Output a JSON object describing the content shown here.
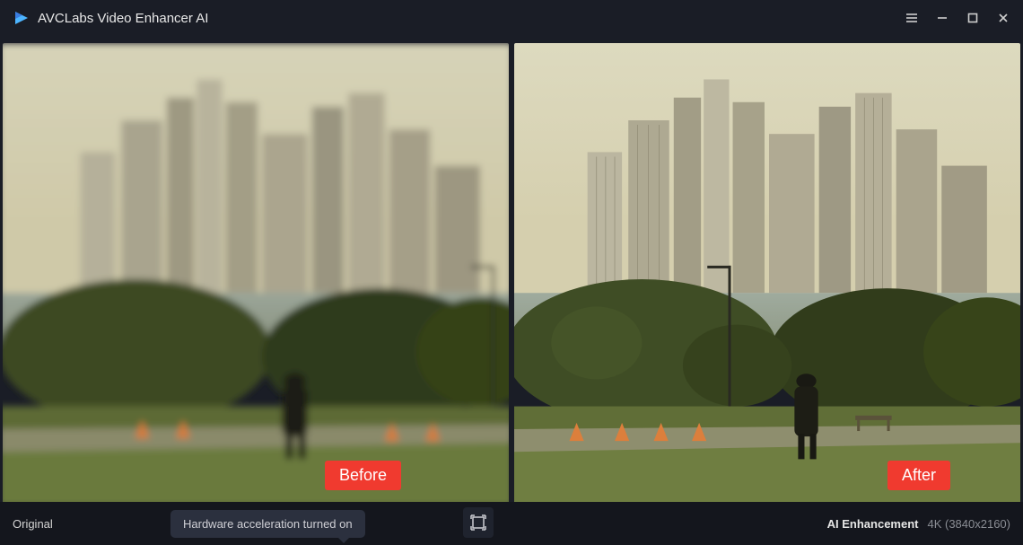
{
  "header": {
    "app_title": "AVCLabs Video Enhancer AI"
  },
  "comparison": {
    "before_label": "Before",
    "after_label": "After"
  },
  "footer": {
    "left_label": "Original",
    "tooltip": "Hardware acceleration turned on",
    "ai_label": "AI Enhancement",
    "resolution": "4K (3840x2160)"
  }
}
